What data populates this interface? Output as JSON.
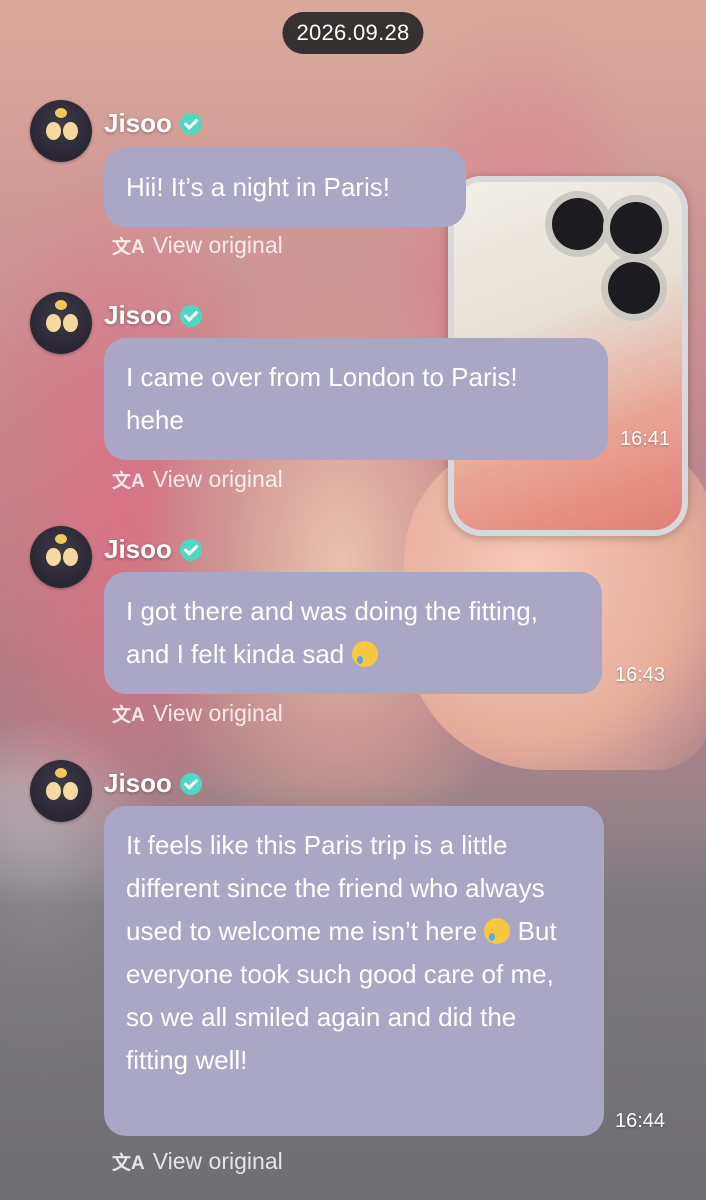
{
  "date": "2026.09.28",
  "messages": [
    {
      "sender": "Jisoo",
      "text": "Hii! It’s a night in Paris!",
      "time": "",
      "translation_link": "View original"
    },
    {
      "sender": "Jisoo",
      "text": "I came over from London to Paris! hehe",
      "time": "16:41",
      "translation_link": "View original"
    },
    {
      "sender": "Jisoo",
      "text_lines": [
        "I got there and was doing the fitting, and I felt kinda sad"
      ],
      "emoji": "crying-face",
      "time": "16:43",
      "translation_link": "View original"
    },
    {
      "sender": "Jisoo",
      "text_part1": "It feels like this Paris trip is a little different since the friend who always used to welcome me isn’t here",
      "emoji": "face-holding-back-tears",
      "text_part2": "But everyone took such good care of me, so we all smiled again and did the fitting well!",
      "time": "16:44",
      "translation_link": "View original"
    }
  ],
  "icons": {
    "verified": "verified-check-icon",
    "translate": "translate-icon"
  },
  "colors": {
    "bubble": "#a9a6c6",
    "verified": "#4fd7c2",
    "date_pill": "#202022"
  }
}
